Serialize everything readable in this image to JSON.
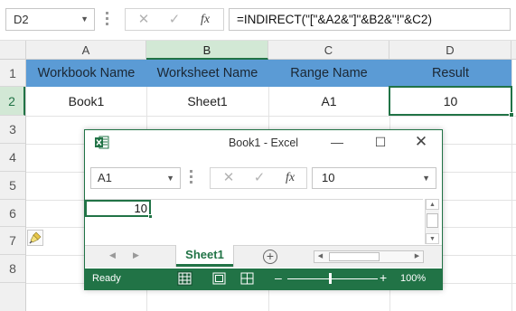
{
  "formula_bar": {
    "name_box": "D2",
    "fx_label": "fx",
    "formula": "=INDIRECT(\"[\"&A2&\"]\"&B2&\"!\"&C2)"
  },
  "columns": [
    "A",
    "B",
    "C",
    "D"
  ],
  "selected_column": "B",
  "rows": [
    "1",
    "2",
    "3",
    "4",
    "5",
    "6",
    "7",
    "8"
  ],
  "table": {
    "headers": [
      "Workbook Name",
      "Worksheet Name",
      "Range Name",
      "Result"
    ],
    "values": [
      "Book1",
      "Sheet1",
      "A1",
      "10"
    ]
  },
  "colors": {
    "header_fill": "#5b9bd5",
    "excel_green": "#217346"
  },
  "mini_window": {
    "title": "Book1 - Excel",
    "name_box": "A1",
    "fx_label": "fx",
    "formula_value": "10",
    "cell_a1": "10",
    "sheet_tab": "Sheet1",
    "status": "Ready",
    "zoom": "100%"
  }
}
